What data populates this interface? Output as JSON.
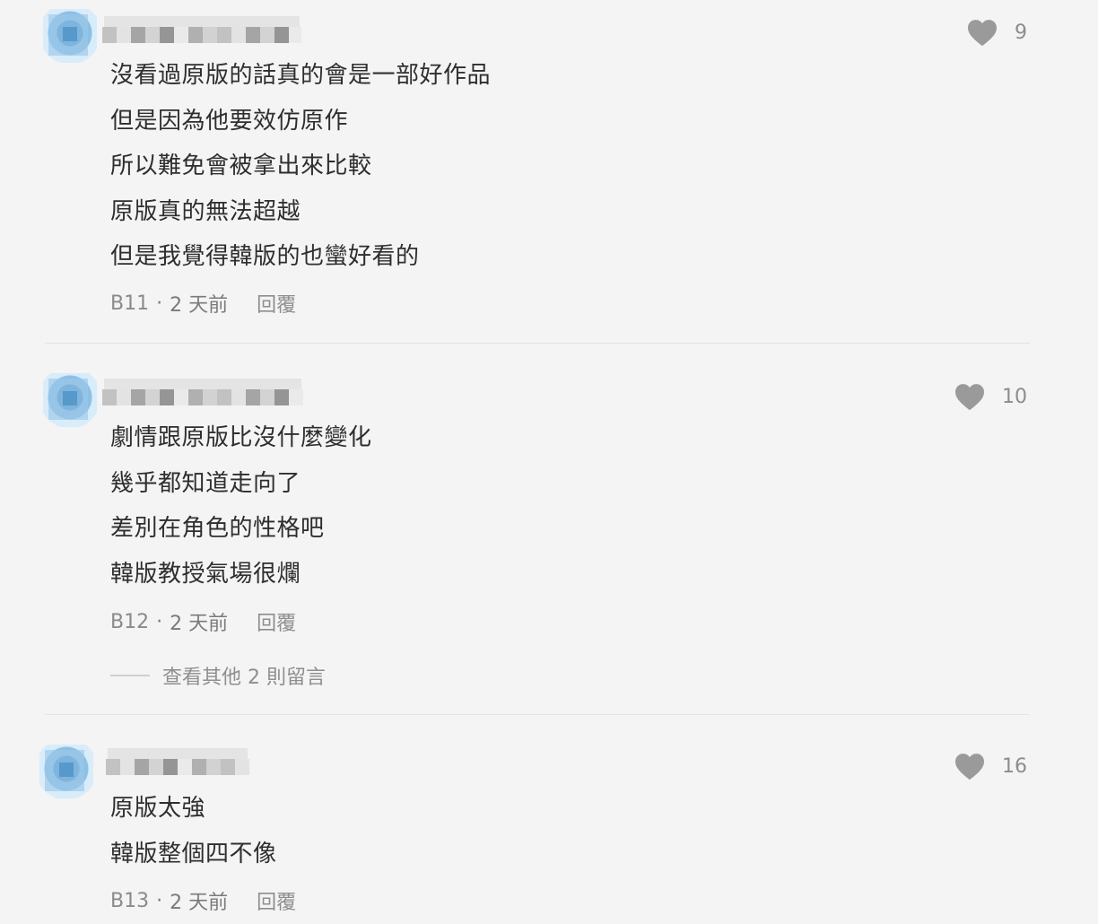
{
  "comments": [
    {
      "likes": "9",
      "lines": [
        "沒看過原版的話真的會是一部好作品",
        "但是因為他要效仿原作",
        "所以難免會被拿出來比較",
        "原版真的無法超越",
        "但是我覺得韓版的也蠻好看的"
      ],
      "floor": "B11",
      "time": "2 天前",
      "reply": "回覆"
    },
    {
      "likes": "10",
      "lines": [
        "劇情跟原版比沒什麼變化",
        "幾乎都知道走向了",
        "差別在角色的性格吧",
        "韓版教授氣場很爛"
      ],
      "floor": "B12",
      "time": "2 天前",
      "reply": "回覆",
      "more": "查看其他 2 則留言"
    },
    {
      "likes": "16",
      "lines": [
        "原版太強",
        "韓版整個四不像"
      ],
      "floor": "B13",
      "time": "2 天前",
      "reply": "回覆"
    }
  ],
  "separator": "·",
  "colors": {
    "background": "#f4f4f4",
    "text": "#2e2e2e",
    "muted": "#8e8e8e",
    "heart": "#9a9a9a"
  },
  "icons": {
    "like": "heart-icon"
  }
}
